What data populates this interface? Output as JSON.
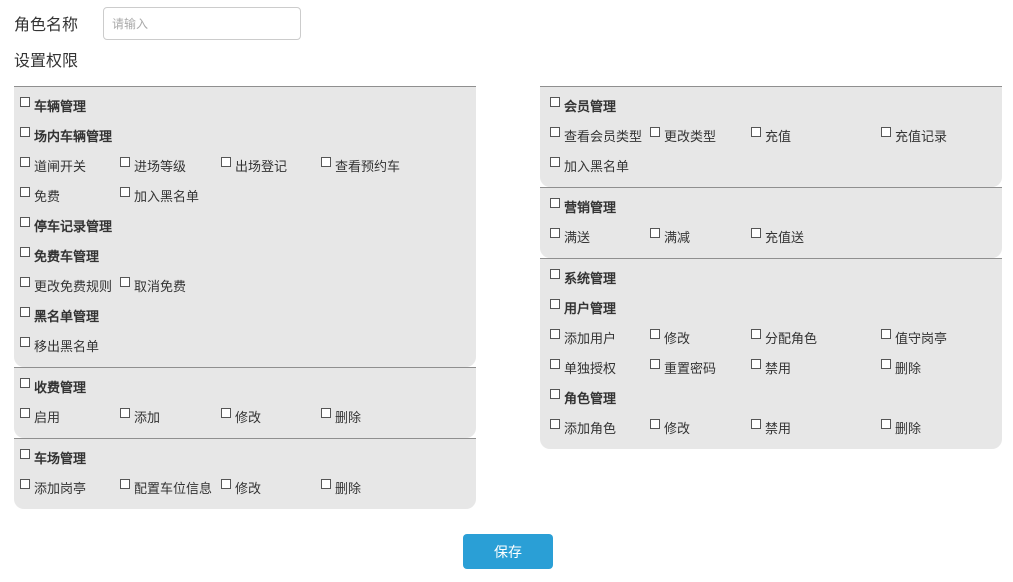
{
  "form": {
    "role_name_label": "角色名称",
    "role_name_placeholder": "请输入",
    "permissions_label": "设置权限",
    "save_label": "保存"
  },
  "left_groups": [
    {
      "rows": [
        [
          {
            "label": "车辆管理",
            "bold": true
          }
        ],
        [
          {
            "label": "场内车辆管理",
            "bold": true
          }
        ],
        [
          {
            "label": "道闸开关"
          },
          {
            "label": "进场等级"
          },
          {
            "label": "出场登记"
          },
          {
            "label": "查看预约车"
          }
        ],
        [
          {
            "label": "免费"
          },
          {
            "label": "加入黑名单"
          }
        ],
        [
          {
            "label": "停车记录管理",
            "bold": true
          }
        ],
        [
          {
            "label": "免费车管理",
            "bold": true
          }
        ],
        [
          {
            "label": "更改免费规则"
          },
          {
            "label": "取消免费"
          }
        ],
        [
          {
            "label": "黑名单管理",
            "bold": true
          }
        ],
        [
          {
            "label": "移出黑名单"
          }
        ]
      ]
    },
    {
      "rows": [
        [
          {
            "label": "收费管理",
            "bold": true
          }
        ],
        [
          {
            "label": "启用"
          },
          {
            "label": "添加"
          },
          {
            "label": "修改"
          },
          {
            "label": "删除"
          }
        ]
      ]
    },
    {
      "rows": [
        [
          {
            "label": "车场管理",
            "bold": true
          }
        ],
        [
          {
            "label": "添加岗亭"
          },
          {
            "label": "配置车位信息"
          },
          {
            "label": "修改"
          },
          {
            "label": "删除"
          }
        ]
      ]
    }
  ],
  "right_groups": [
    {
      "rows": [
        [
          {
            "label": "会员管理",
            "bold": true
          }
        ],
        [
          {
            "label": "查看会员类型"
          },
          {
            "label": "更改类型"
          },
          {
            "label": "充值"
          },
          {
            "label": "充值记录"
          }
        ],
        [
          {
            "label": "加入黑名单"
          }
        ]
      ]
    },
    {
      "rows": [
        [
          {
            "label": "营销管理",
            "bold": true
          }
        ],
        [
          {
            "label": "满送"
          },
          {
            "label": "满减"
          },
          {
            "label": "充值送"
          }
        ]
      ]
    },
    {
      "rows": [
        [
          {
            "label": "系统管理",
            "bold": true
          }
        ],
        [
          {
            "label": "用户管理",
            "bold": true
          }
        ],
        [
          {
            "label": "添加用户"
          },
          {
            "label": "修改"
          },
          {
            "label": "分配角色"
          },
          {
            "label": "值守岗亭"
          }
        ],
        [
          {
            "label": "单独授权"
          },
          {
            "label": "重置密码"
          },
          {
            "label": "禁用"
          },
          {
            "label": "删除"
          }
        ],
        [
          {
            "label": "角色管理",
            "bold": true
          }
        ],
        [
          {
            "label": "添加角色"
          },
          {
            "label": "修改"
          },
          {
            "label": "禁用"
          },
          {
            "label": "删除"
          }
        ]
      ]
    }
  ]
}
